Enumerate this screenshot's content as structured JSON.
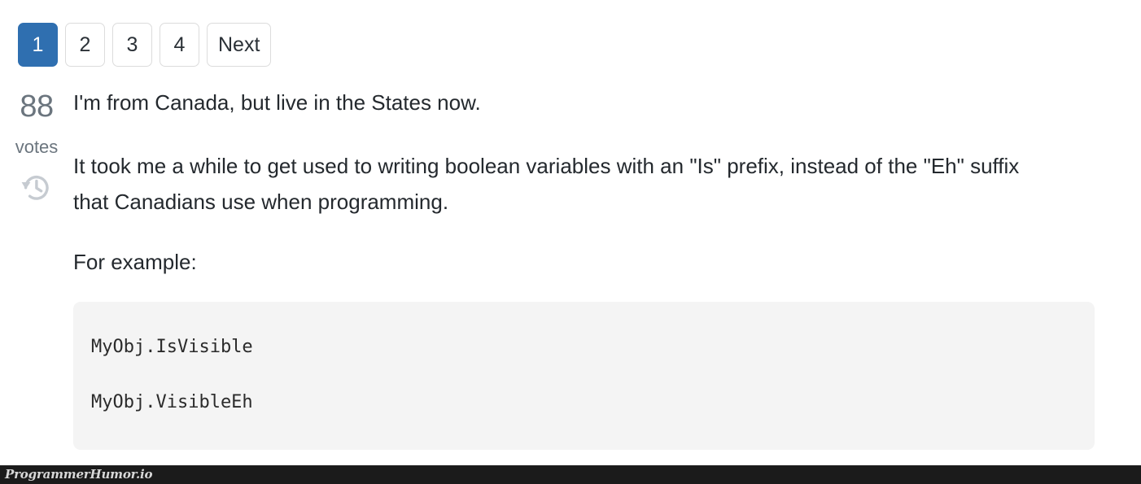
{
  "pagination": {
    "pages": [
      {
        "label": "1",
        "active": true
      },
      {
        "label": "2",
        "active": false
      },
      {
        "label": "3",
        "active": false
      },
      {
        "label": "4",
        "active": false
      },
      {
        "label": "Next",
        "active": false
      }
    ],
    "active_color": "#2f6fb0",
    "border_color": "#dcdcdc"
  },
  "post": {
    "votes": {
      "count": "88",
      "label": "votes",
      "icon": "history-icon",
      "color": "#6b757e"
    },
    "paragraphs": [
      "I'm from Canada, but live in the States now.",
      "It took me a while to get used to writing boolean variables with an \"Is\" prefix, instead of the \"Eh\" suffix that Canadians use when programming.",
      "For example:"
    ],
    "code": {
      "line1": "MyObj.IsVisible",
      "line2": "MyObj.VisibleEh",
      "background": "#f4f4f4"
    }
  },
  "footer": {
    "watermark": "ProgrammerHumor.io",
    "background": "#1b1b1b"
  }
}
